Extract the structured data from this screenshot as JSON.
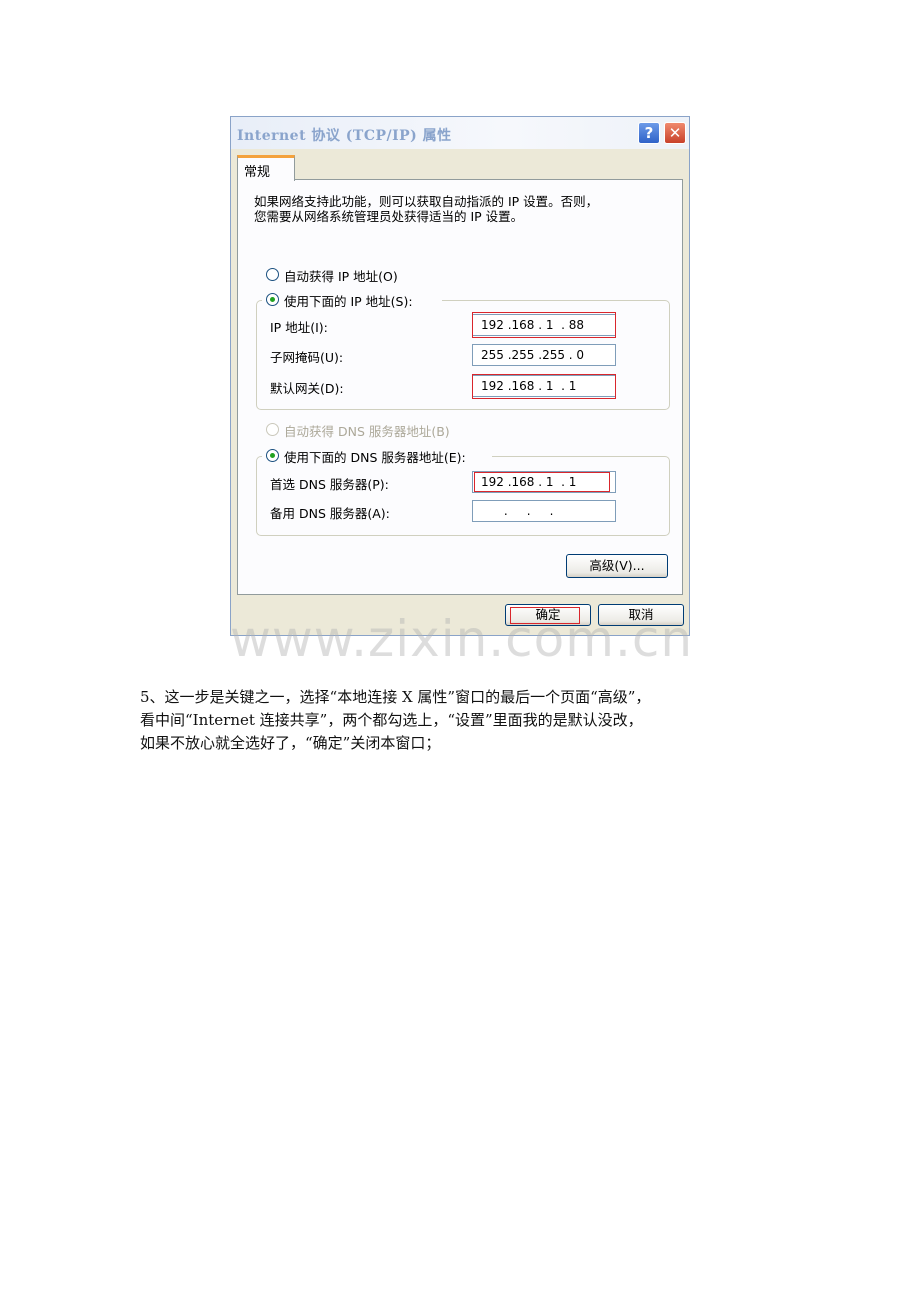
{
  "dialog": {
    "title": "Internet 协议 (TCP/IP) 属性",
    "help_label": "?",
    "close_label": "✕",
    "tab_general": "常规",
    "description_line1": "如果网络支持此功能，则可以获取自动指派的 IP 设置。否则，",
    "description_line2": "您需要从网络系统管理员处获得适当的 IP 设置。",
    "radio_auto_ip": "自动获得 IP 地址(O)",
    "radio_manual_ip": "使用下面的 IP 地址(S):",
    "ip_label": "IP 地址(I):",
    "ip_value": "192 .168 . 1  . 88",
    "subnet_label": "子网掩码(U):",
    "subnet_value": "255 .255 .255 . 0",
    "gateway_label": "默认网关(D):",
    "gateway_value": "192 .168 . 1  . 1",
    "radio_auto_dns": "自动获得 DNS 服务器地址(B)",
    "radio_manual_dns": "使用下面的 DNS 服务器地址(E):",
    "preferred_dns_label": "首选 DNS 服务器(P):",
    "preferred_dns_value": "192 .168 . 1  . 1",
    "alternate_dns_label": "备用 DNS 服务器(A):",
    "alternate_dns_value": "      .     .     .",
    "advanced_label": "高级(V)...",
    "ok_label": "确定",
    "cancel_label": "取消",
    "state": {
      "ip_mode": "manual",
      "dns_mode": "manual"
    }
  },
  "watermark": "www.zixin.com.cn",
  "paragraph": {
    "line1": "5、这一步是关键之一，选择“本地连接 X 属性”窗口的最后一个页面“高级”，",
    "line2": "看中间“Internet 连接共享”，两个都勾选上，“设置”里面我的是默认没改，",
    "line3": "如果不放心就全选好了，“确定”关闭本窗口；"
  },
  "colors": {
    "highlight_outline": "#d9262c",
    "dialog_bg": "#ece9d8",
    "tab_accent": "#f4a23c",
    "radio_dot": "#21a121"
  }
}
